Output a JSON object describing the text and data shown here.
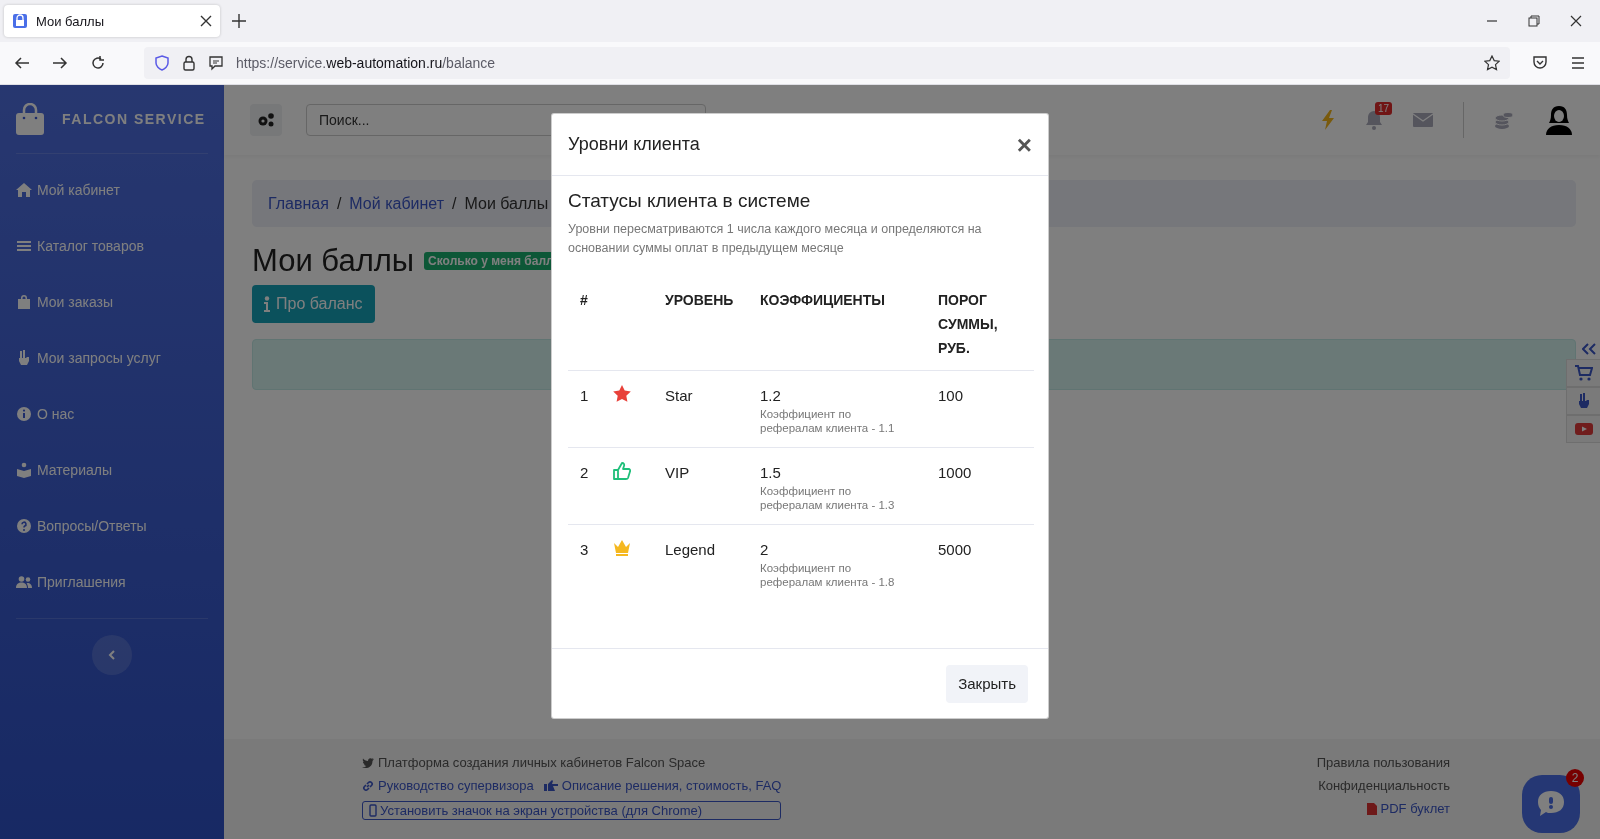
{
  "browser": {
    "tab_title": "Мои баллы",
    "url": {
      "scheme": "https://service.",
      "domain": "web-automation.ru",
      "path": "/balance"
    }
  },
  "sidebar": {
    "brand": "FALCON SERVICE",
    "items": [
      {
        "label": "Мой кабинет"
      },
      {
        "label": "Каталог товаров"
      },
      {
        "label": "Мои заказы"
      },
      {
        "label": "Мои запросы услуг"
      },
      {
        "label": "О нас"
      },
      {
        "label": "Материалы"
      },
      {
        "label": "Вопросы/Ответы"
      },
      {
        "label": "Приглашения"
      }
    ]
  },
  "header": {
    "search": {
      "placeholder": "Поиск..."
    },
    "notification_count": "17"
  },
  "breadcrumb": [
    {
      "label": "Главная",
      "kind": "link"
    },
    {
      "label": "/",
      "kind": "separator"
    },
    {
      "label": "Мой кабинет",
      "kind": "link"
    },
    {
      "label": "/",
      "kind": "separator"
    },
    {
      "label": "Мои баллы",
      "kind": "current"
    }
  ],
  "page_title": "Мои баллы",
  "title_badge": "Сколько у меня балл",
  "info_button": "Про баланс",
  "modal": {
    "title": "Уровни клиента",
    "close": "×",
    "heading": "Статусы клиента в системе",
    "description": "Уровни пересматриваются 1 числа каждого месяца и определяются на основании суммы оплат в предыдущем месяце",
    "table": {
      "columns": [
        "#",
        "УРОВЕНЬ",
        "КОЭФФИЦИЕНТЫ",
        "ПОРОГ СУММЫ, РУБ."
      ],
      "rows": [
        {
          "number": "1",
          "kind": "star",
          "level": "Star",
          "coefficient": "1.2",
          "note": "Коэффициент по рефералам клиента - 1.1",
          "threshold": "100"
        },
        {
          "number": "2",
          "kind": "thumbs",
          "level": "VIP",
          "coefficient": "1.5",
          "note": "Коэффициент по рефералам клиента - 1.3",
          "threshold": "1000"
        },
        {
          "number": "3",
          "kind": "crown",
          "level": "Legend",
          "coefficient": "2",
          "note": "Коэффициент по рефералам клиента - 1.8",
          "threshold": "5000"
        }
      ]
    },
    "close_button": "Закрыть"
  },
  "footer": {
    "platform": "Платформа создания личных кабинетов Falcon Space",
    "links": [
      "Руководство супервизора",
      "Описание решения, стоимость, FAQ"
    ],
    "install_button": "Установить значок на экран устройства (для Chrome)",
    "right_links": [
      "Правила пользования",
      "Конфиденциальность",
      "PDF буклет"
    ]
  },
  "chat": {
    "badge": "2"
  }
}
